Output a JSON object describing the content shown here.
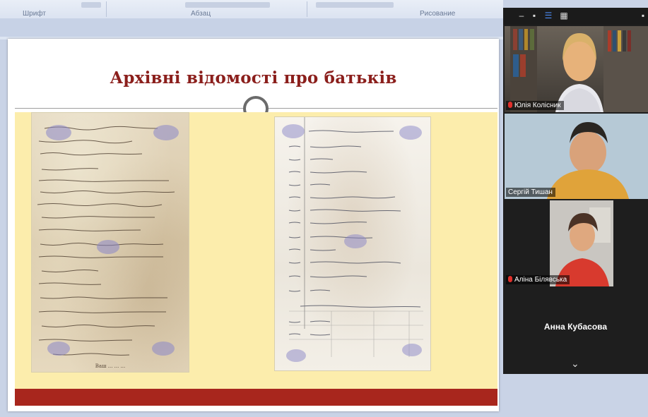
{
  "ribbon": {
    "groups": [
      "Шрифт",
      "Абзац",
      "Рисование"
    ]
  },
  "slide": {
    "title": "Архівні відомості про батьків",
    "documents": [
      {
        "name": "archival-record-left",
        "footer": "Ваш ... ... ..."
      },
      {
        "name": "archival-record-right"
      }
    ],
    "colors": {
      "title": "#8b1f1c",
      "content_background": "#fcedac",
      "bottom_bar": "#a8261d"
    }
  },
  "zoom": {
    "toolbar_icons": [
      "minimize-icon",
      "restore-icon",
      "speaker-view-icon",
      "gallery-view-icon",
      "close-icon"
    ],
    "participants": [
      {
        "name": "Юлія Колісник",
        "muted": true,
        "video": true
      },
      {
        "name": "Сергій Тишан",
        "muted": false,
        "video": true
      },
      {
        "name": "Аліна Білявська",
        "muted": true,
        "video": true
      },
      {
        "name": "Анна Кубасова",
        "muted": false,
        "video": false
      }
    ],
    "collapse_icon": "chevron-down-icon"
  }
}
